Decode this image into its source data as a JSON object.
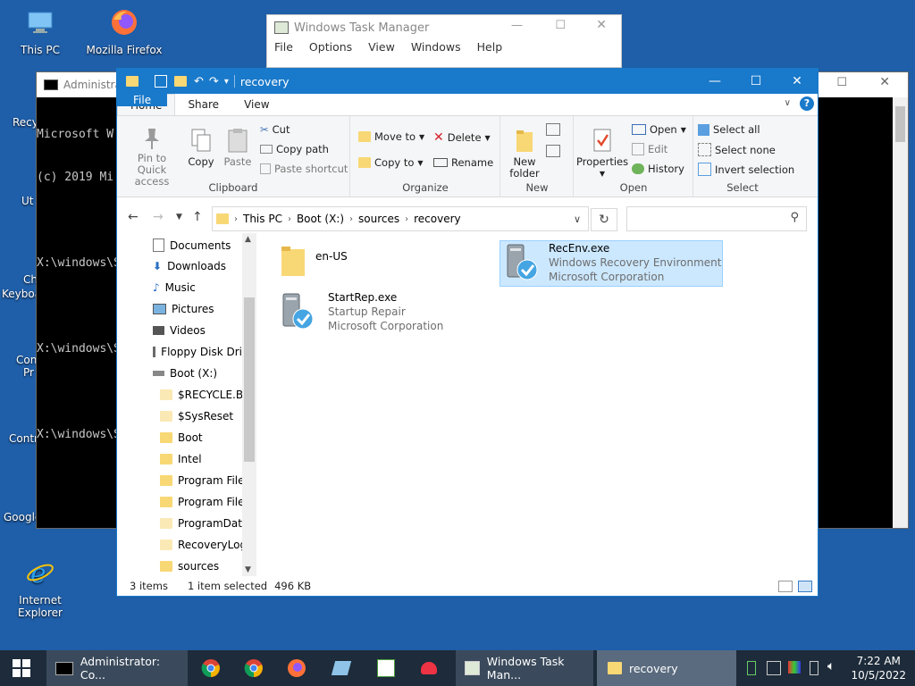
{
  "desktop": {
    "icons": [
      {
        "label": "This PC"
      },
      {
        "label": "Mozilla Firefox"
      },
      {
        "label": "Internet Explorer"
      },
      {
        "label": "Recy"
      },
      {
        "label": "Ut"
      },
      {
        "label": "Ch"
      },
      {
        "label": "Keyboa"
      },
      {
        "label": "Con"
      },
      {
        "label": "Pr"
      },
      {
        "label": "Contr"
      },
      {
        "label": "Google"
      }
    ]
  },
  "console": {
    "title": "Administrat",
    "lines": [
      "Microsoft W",
      "(c) 2019 Mi",
      "",
      "X:\\windows\\S",
      "",
      "X:\\windows\\S",
      "",
      "X:\\windows\\S"
    ]
  },
  "task_manager": {
    "title": "Windows Task Manager",
    "menu": [
      "File",
      "Options",
      "View",
      "Windows",
      "Help"
    ]
  },
  "explorer": {
    "title": "recovery",
    "tabs": [
      "File",
      "Home",
      "Share",
      "View"
    ],
    "ribbon": {
      "clipboard": {
        "label": "Clipboard",
        "pin": "Pin to Quick access",
        "copy": "Copy",
        "paste": "Paste",
        "cut": "Cut",
        "copy_path": "Copy path",
        "paste_shortcut": "Paste shortcut"
      },
      "organize": {
        "label": "Organize",
        "move_to": "Move to",
        "copy_to": "Copy to",
        "delete": "Delete",
        "rename": "Rename"
      },
      "new": {
        "label": "New",
        "new_folder": "New folder"
      },
      "open": {
        "label": "Open",
        "properties": "Properties",
        "open": "Open",
        "edit": "Edit",
        "history": "History"
      },
      "select": {
        "label": "Select",
        "select_all": "Select all",
        "select_none": "Select none",
        "invert": "Invert selection"
      }
    },
    "address": {
      "crumbs": [
        "This PC",
        "Boot (X:)",
        "sources",
        "recovery"
      ]
    },
    "nav_items": [
      {
        "label": "Documents"
      },
      {
        "label": "Downloads"
      },
      {
        "label": "Music"
      },
      {
        "label": "Pictures"
      },
      {
        "label": "Videos"
      },
      {
        "label": "Floppy Disk Dri"
      },
      {
        "label": "Boot (X:)"
      },
      {
        "label": "$RECYCLE.BIN"
      },
      {
        "label": "$SysReset"
      },
      {
        "label": "Boot"
      },
      {
        "label": "Intel"
      },
      {
        "label": "Program Files"
      },
      {
        "label": "Program Files"
      },
      {
        "label": "ProgramData"
      },
      {
        "label": "RecoveryLogs"
      },
      {
        "label": "sources"
      }
    ],
    "files": [
      {
        "name": "en-US",
        "line1": "",
        "line2": ""
      },
      {
        "name": "RecEnv.exe",
        "line1": "Windows Recovery Environment",
        "line2": "Microsoft Corporation"
      },
      {
        "name": "StartRep.exe",
        "line1": "Startup Repair",
        "line2": "Microsoft Corporation"
      }
    ],
    "status": {
      "items": "3 items",
      "selected": "1 item selected",
      "size": "496 KB"
    }
  },
  "taskbar": {
    "windows": [
      {
        "label": "Administrator: Co..."
      },
      {
        "label": "Windows Task Man..."
      },
      {
        "label": "recovery"
      }
    ],
    "time": "7:22 AM",
    "date": "10/5/2022"
  },
  "colors": {
    "accent": "#1979ca",
    "desktop": "#1f5ea8",
    "taskbar": "#1d2b3a",
    "selection": "#cce8ff"
  }
}
